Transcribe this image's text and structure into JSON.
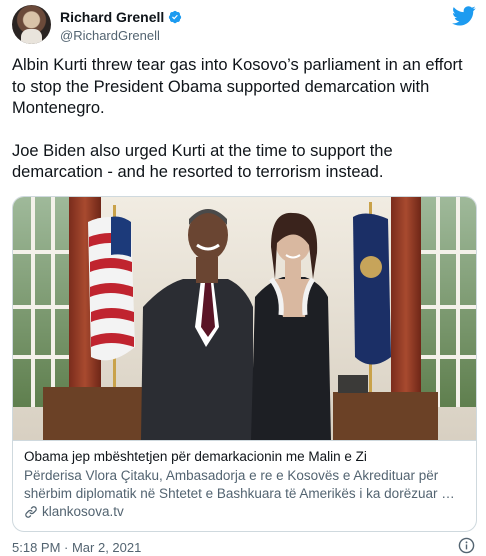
{
  "author": {
    "name": "Richard Grenell",
    "handle": "@RichardGrenell"
  },
  "tweet": {
    "paragraph1": "Albin Kurti threw tear gas into Kosovo’s parliament in an effort to stop the President Obama supported demarcation with Montenegro.",
    "paragraph2": "Joe Biden also urged Kurti at the time to support the demarcation - and he resorted to terrorism instead."
  },
  "card": {
    "title": "Obama jep mbështetjen për demarkacionin me Malin e Zi",
    "description": "Përderisa Vlora Çitaku, Ambasadorja e re e Kosovës e Akredituar për shërbim diplomatik në Shtetet e Bashkuara të Amerikës i ka dorëzuar …",
    "domain": "klankosova.tv"
  },
  "footer": {
    "timestamp": "5:18 PM · Mar 2, 2021"
  },
  "icons": {
    "verified": "verified-badge-icon",
    "brand": "twitter-bird-icon",
    "link": "link-icon",
    "info": "info-icon"
  },
  "colors": {
    "twitter_blue": "#1d9bf0",
    "secondary_text": "#536471",
    "border": "#cfd9de"
  }
}
